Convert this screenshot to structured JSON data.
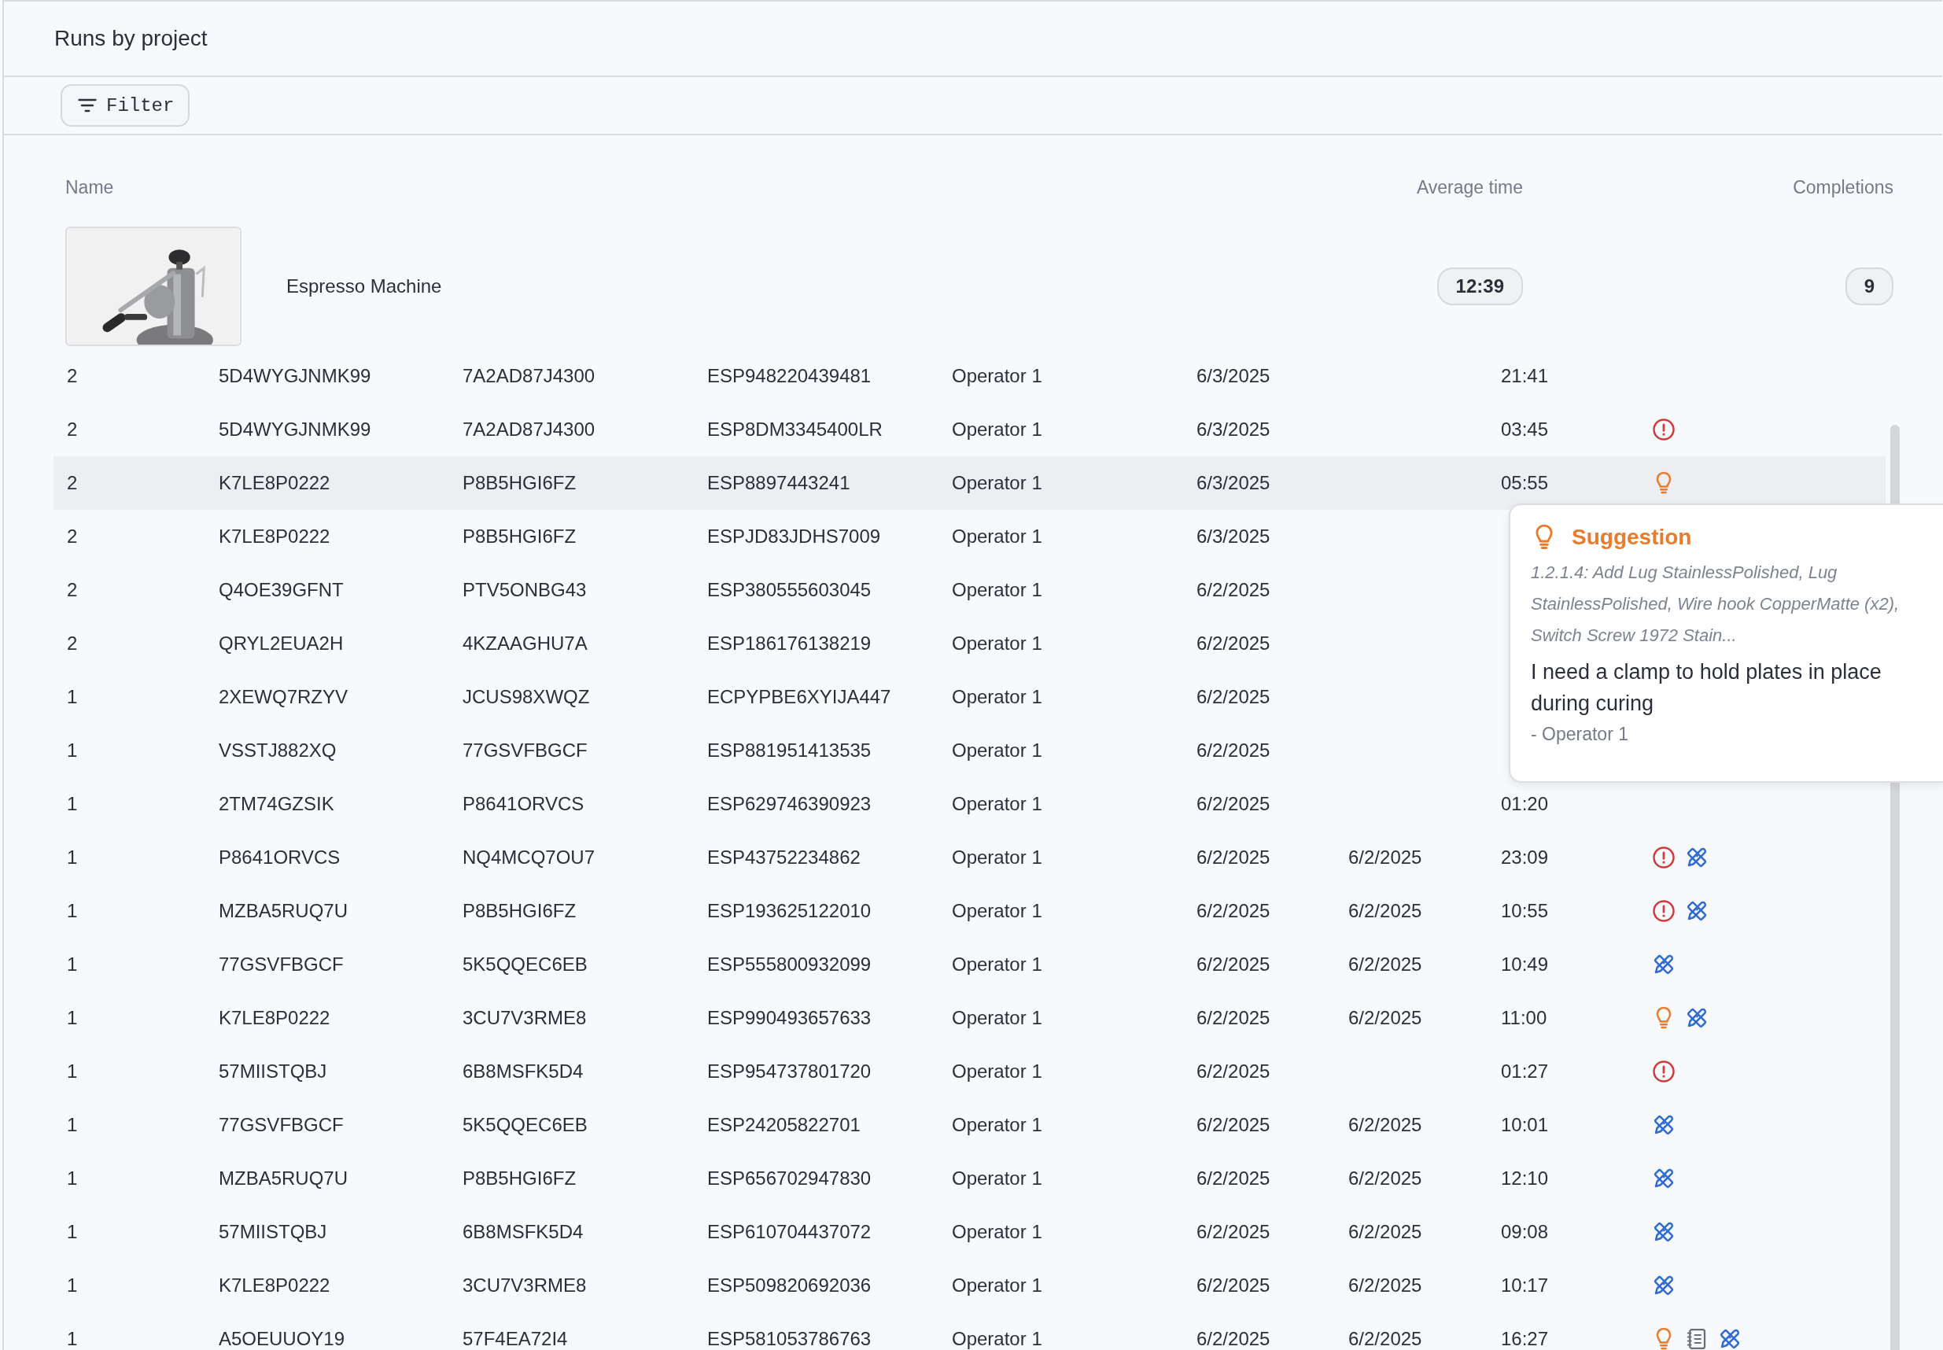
{
  "title": "Runs by project",
  "filter_button": {
    "label": "Filter"
  },
  "table": {
    "columns": [
      "Name",
      "Average time",
      "Completions"
    ],
    "project": {
      "name": "Espresso Machine",
      "average_time": "12:39",
      "completions": "9"
    },
    "rows": [
      {
        "highlighted": false,
        "column_1": "2",
        "column_2": "5D4WYGJNMK99",
        "column_3": "7A2AD87J4300",
        "column_4": "ESP948220439481",
        "column_5": "Operator 1",
        "column_6": "6/3/2025",
        "column_8": "21:41",
        "alert": false,
        "suggestion": false,
        "notes": false,
        "tools": false
      },
      {
        "highlighted": false,
        "column_1": "2",
        "column_2": "5D4WYGJNMK99",
        "column_3": "7A2AD87J4300",
        "column_4": "ESP8DM3345400LR",
        "column_5": "Operator 1",
        "column_6": "6/3/2025",
        "column_8": "03:45",
        "alert": true,
        "suggestion": false,
        "notes": false,
        "tools": false
      },
      {
        "highlighted": true,
        "column_1": "2",
        "column_2": "K7LE8P0222",
        "column_3": "P8B5HGI6FZ",
        "column_4": "ESP8897443241",
        "column_5": "Operator 1",
        "column_6": "6/3/2025",
        "column_8": "05:55",
        "alert": false,
        "suggestion": true,
        "notes": false,
        "tools": false
      },
      {
        "highlighted": false,
        "column_1": "2",
        "column_2": "K7LE8P0222",
        "column_3": "P8B5HGI6FZ",
        "column_4": "ESPJD83JDHS7009",
        "column_5": "Operator 1",
        "column_6": "6/3/2025"
      },
      {
        "highlighted": false,
        "column_1": "2",
        "column_2": "Q4OE39GFNT",
        "column_3": "PTV5ONBG43",
        "column_4": "ESP380555603045",
        "column_5": "Operator 1",
        "column_6": "6/2/2025"
      },
      {
        "highlighted": false,
        "column_1": "2",
        "column_2": "QRYL2EUA2H",
        "column_3": "4KZAAGHU7A",
        "column_4": "ESP186176138219",
        "column_5": "Operator 1",
        "column_6": "6/2/2025"
      },
      {
        "highlighted": false,
        "column_1": "1",
        "column_2": "2XEWQ7RZYV",
        "column_3": "JCUS98XWQZ",
        "column_4": "ECPYPBE6XYIJA447",
        "column_5": "Operator 1",
        "column_6": "6/2/2025"
      },
      {
        "highlighted": false,
        "column_1": "1",
        "column_2": "VSSTJ882XQ",
        "column_3": "77GSVFBGCF",
        "column_4": "ESP881951413535",
        "column_5": "Operator 1",
        "column_6": "6/2/2025"
      },
      {
        "highlighted": false,
        "column_1": "1",
        "column_2": "2TM74GZSIK",
        "column_3": "P8641ORVCS",
        "column_4": "ESP629746390923",
        "column_5": "Operator 1",
        "column_6": "6/2/2025",
        "column_8": "01:20",
        "alert": false,
        "suggestion": false,
        "notes": false,
        "tools": false
      },
      {
        "highlighted": false,
        "column_1": "1",
        "column_2": "P8641ORVCS",
        "column_3": "NQ4MCQ7OU7",
        "column_4": "ESP43752234862",
        "column_5": "Operator 1",
        "column_6": "6/2/2025",
        "column_7": "6/2/2025",
        "column_8": "23:09",
        "alert": true,
        "suggestion": false,
        "notes": false,
        "tools": true
      },
      {
        "highlighted": false,
        "column_1": "1",
        "column_2": "MZBA5RUQ7U",
        "column_3": "P8B5HGI6FZ",
        "column_4": "ESP193625122010",
        "column_5": "Operator 1",
        "column_6": "6/2/2025",
        "column_7": "6/2/2025",
        "column_8": "10:55",
        "alert": true,
        "suggestion": false,
        "notes": false,
        "tools": true
      },
      {
        "highlighted": false,
        "column_1": "1",
        "column_2": "77GSVFBGCF",
        "column_3": "5K5QQEC6EB",
        "column_4": "ESP555800932099",
        "column_5": "Operator 1",
        "column_6": "6/2/2025",
        "column_7": "6/2/2025",
        "column_8": "10:49",
        "alert": false,
        "suggestion": false,
        "notes": false,
        "tools": true
      },
      {
        "highlighted": false,
        "column_1": "1",
        "column_2": "K7LE8P0222",
        "column_3": "3CU7V3RME8",
        "column_4": "ESP990493657633",
        "column_5": "Operator 1",
        "column_6": "6/2/2025",
        "column_7": "6/2/2025",
        "column_8": "11:00",
        "alert": false,
        "suggestion": true,
        "notes": false,
        "tools": true
      },
      {
        "highlighted": false,
        "column_1": "1",
        "column_2": "57MIISTQBJ",
        "column_3": "6B8MSFK5D4",
        "column_4": "ESP954737801720",
        "column_5": "Operator 1",
        "column_6": "6/2/2025",
        "column_8": "01:27",
        "alert": true,
        "suggestion": false,
        "notes": false,
        "tools": false
      },
      {
        "highlighted": false,
        "column_1": "1",
        "column_2": "77GSVFBGCF",
        "column_3": "5K5QQEC6EB",
        "column_4": "ESP24205822701",
        "column_5": "Operator 1",
        "column_6": "6/2/2025",
        "column_7": "6/2/2025",
        "column_8": "10:01",
        "alert": false,
        "suggestion": false,
        "notes": false,
        "tools": true
      },
      {
        "highlighted": false,
        "column_1": "1",
        "column_2": "MZBA5RUQ7U",
        "column_3": "P8B5HGI6FZ",
        "column_4": "ESP656702947830",
        "column_5": "Operator 1",
        "column_6": "6/2/2025",
        "column_7": "6/2/2025",
        "column_8": "12:10",
        "alert": false,
        "suggestion": false,
        "notes": false,
        "tools": true
      },
      {
        "highlighted": false,
        "column_1": "1",
        "column_2": "57MIISTQBJ",
        "column_3": "6B8MSFK5D4",
        "column_4": "ESP610704437072",
        "column_5": "Operator 1",
        "column_6": "6/2/2025",
        "column_7": "6/2/2025",
        "column_8": "09:08",
        "alert": false,
        "suggestion": false,
        "notes": false,
        "tools": true
      },
      {
        "highlighted": false,
        "column_1": "1",
        "column_2": "K7LE8P0222",
        "column_3": "3CU7V3RME8",
        "column_4": "ESP509820692036",
        "column_5": "Operator 1",
        "column_6": "6/2/2025",
        "column_7": "6/2/2025",
        "column_8": "10:17",
        "alert": false,
        "suggestion": false,
        "notes": false,
        "tools": true
      },
      {
        "highlighted": false,
        "column_1": "1",
        "column_2": "A5OEUUOY19",
        "column_3": "57F4EA72I4",
        "column_4": "ESP581053786763",
        "column_5": "Operator 1",
        "column_6": "6/2/2025",
        "column_7": "6/2/2025",
        "column_8": "16:27",
        "alert": false,
        "suggestion": true,
        "notes": true,
        "tools": true
      }
    ]
  },
  "tooltip": {
    "title": "Suggestion",
    "step": "1.2.1.4: Add Lug StainlessPolished, Lug StainlessPolished, Wire hook CopperMatte (x2), Switch Screw 1972 Stain...",
    "message": "I need a clamp to hold plates in place during curing",
    "author": "- Operator 1"
  }
}
